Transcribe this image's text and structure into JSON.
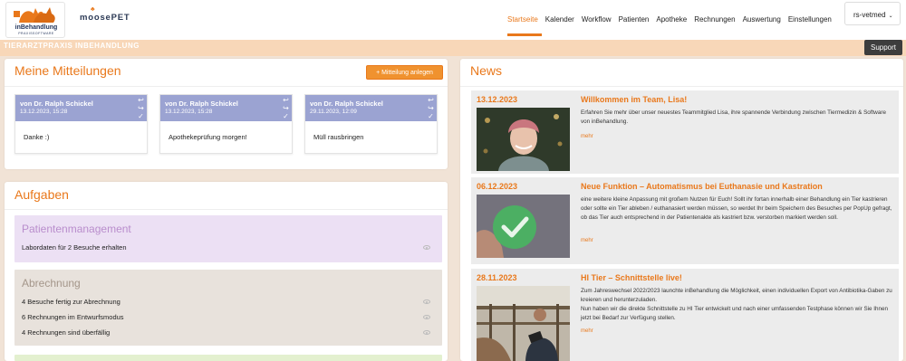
{
  "colors": {
    "accent": "#e9781b",
    "card_header": "#9ba3d2",
    "band": "#f8d7b8",
    "patient_bg": "#ece0f4",
    "billing_bg": "#e8e2dc"
  },
  "header": {
    "logo_name": "inBehandlung",
    "logo_sub": "PRAXISSOFTWARE",
    "partner_logo": "moosePET",
    "nav": [
      "Startseite",
      "Kalender",
      "Workflow",
      "Patienten",
      "Apotheke",
      "Rechnungen",
      "Auswertung",
      "Einstellungen"
    ],
    "active_nav": "Startseite",
    "user": "rs-vetmed",
    "practice_title": "TIERARZTPRAXIS INBEHANDLUNG",
    "support_label": "Support"
  },
  "messages": {
    "title": "Meine Mitteilungen",
    "add_button": "+ Mitteilung anlegen",
    "cards": [
      {
        "from": "von Dr. Ralph Schickel",
        "date": "13.12.2023, 15:28",
        "text": "Danke :)"
      },
      {
        "from": "von Dr. Ralph Schickel",
        "date": "13.12.2023, 15:28",
        "text": "Apothekeprüfung morgen!"
      },
      {
        "from": "von Dr. Ralph Schickel",
        "date": "29.11.2023, 12:09",
        "text": "Müll rausbringen"
      }
    ]
  },
  "tasks": {
    "title": "Aufgaben",
    "groups": [
      {
        "title": "Patientenmanagement",
        "items": [
          "Labordaten für 2 Besuche erhalten"
        ]
      },
      {
        "title": "Abrechnung",
        "items": [
          "4 Besuche fertig zur Abrechnung",
          "6 Rechnungen im Entwurfsmodus",
          "4 Rechnungen sind überfällig"
        ]
      }
    ]
  },
  "news": {
    "title": "News",
    "more_label": "mehr",
    "items": [
      {
        "date": "13.12.2023",
        "title": "Willkommen im Team, Lisa!",
        "text": "Erfahren Sie mehr über unser neuestes Teammitglied Lisa, ihre spannende Verbindung zwischen Tiermedizin & Software von inBehandlung."
      },
      {
        "date": "06.12.2023",
        "title": "Neue Funktion – Automatismus bei Euthanasie und Kastration",
        "text": "eine weitere kleine Anpassung mit großem Nutzen für Euch! Sollt ihr fortan innerhalb einer Behandlung ein Tier kastrieren oder sollte ein Tier ableben / euthanasiert werden müssen, so werdet Ihr beim Speichern des Besuches per PopUp gefragt, ob das Tier auch entsprechend in der Patientenakte als kastriert bzw. verstorben markiert werden soll."
      },
      {
        "date": "28.11.2023",
        "title": "HI Tier – Schnittstelle live!",
        "text1": "Zum Jahreswechsel 2022/2023 launchte inBehandlung die Möglichkeit, einen individuellen Export von Antibiotika-Gaben zu kreieren und herunterzuladen.",
        "text2": "Nun haben wir die direkte Schnittstelle zu HI Tier entwickelt und nach einer umfassenden Testphase können wir Sie Ihnen jetzt bei Bedarf zur Verfügung stellen."
      }
    ]
  }
}
